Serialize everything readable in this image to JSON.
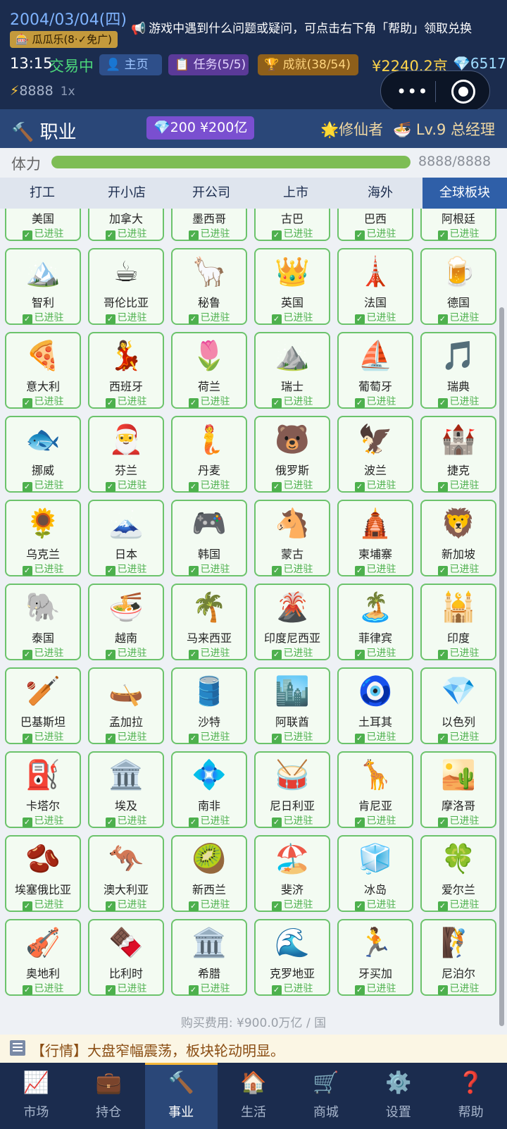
{
  "header": {
    "date": "2004/03/04(四)",
    "ticker": "游戏中遇到什么问题或疑问，可点击右下角「帮助」领取兑换",
    "melon_badge": "🎰 瓜瓜乐(8·✓免广)",
    "time": "13:15",
    "market_status": "交易中",
    "home_btn": "👤 主页",
    "task_btn": "📋 任务(5/5)",
    "achievement_btn": "🏆 成就(38/54)",
    "money": "¥2240.2京",
    "gems": "💎6517",
    "energy": "8888",
    "multiplier": "1x"
  },
  "career": {
    "icon": "🔨",
    "title": "职业",
    "unlock_price": "💎200 ¥200亿",
    "role": "🌟修仙者",
    "level": "🍜 Lv.9 总经理"
  },
  "stamina": {
    "label": "体力",
    "value": "8888/8888",
    "fraction": 1.0,
    "color": "#7dbd55"
  },
  "tabs": [
    {
      "label": "打工",
      "active": false
    },
    {
      "label": "开小店",
      "active": false
    },
    {
      "label": "开公司",
      "active": false
    },
    {
      "label": "上市",
      "active": false
    },
    {
      "label": "海外",
      "active": false
    },
    {
      "label": "全球板块",
      "active": true
    }
  ],
  "status_label": "已进驻",
  "countries": [
    {
      "name": "美国",
      "icon": ""
    },
    {
      "name": "加拿大",
      "icon": ""
    },
    {
      "name": "墨西哥",
      "icon": ""
    },
    {
      "name": "古巴",
      "icon": ""
    },
    {
      "name": "巴西",
      "icon": ""
    },
    {
      "name": "阿根廷",
      "icon": ""
    },
    {
      "name": "智利",
      "icon": "🏔️"
    },
    {
      "name": "哥伦比亚",
      "icon": "☕"
    },
    {
      "name": "秘鲁",
      "icon": "🦙"
    },
    {
      "name": "英国",
      "icon": "👑"
    },
    {
      "name": "法国",
      "icon": "🗼"
    },
    {
      "name": "德国",
      "icon": "🍺"
    },
    {
      "name": "意大利",
      "icon": "🍕"
    },
    {
      "name": "西班牙",
      "icon": "💃"
    },
    {
      "name": "荷兰",
      "icon": "🌷"
    },
    {
      "name": "瑞士",
      "icon": "⛰️"
    },
    {
      "name": "葡萄牙",
      "icon": "⛵"
    },
    {
      "name": "瑞典",
      "icon": "🎵"
    },
    {
      "name": "挪威",
      "icon": "🐟"
    },
    {
      "name": "芬兰",
      "icon": "🎅"
    },
    {
      "name": "丹麦",
      "icon": "🧜"
    },
    {
      "name": "俄罗斯",
      "icon": "🐻"
    },
    {
      "name": "波兰",
      "icon": "🦅"
    },
    {
      "name": "捷克",
      "icon": "🏰"
    },
    {
      "name": "乌克兰",
      "icon": "🌻"
    },
    {
      "name": "日本",
      "icon": "🗻"
    },
    {
      "name": "韩国",
      "icon": "🎮"
    },
    {
      "name": "蒙古",
      "icon": "🐴"
    },
    {
      "name": "柬埔寨",
      "icon": "🛕"
    },
    {
      "name": "新加坡",
      "icon": "🦁"
    },
    {
      "name": "泰国",
      "icon": "🐘"
    },
    {
      "name": "越南",
      "icon": "🍜"
    },
    {
      "name": "马来西亚",
      "icon": "🌴"
    },
    {
      "name": "印度尼西亚",
      "icon": "🌋"
    },
    {
      "name": "菲律宾",
      "icon": "🏝️"
    },
    {
      "name": "印度",
      "icon": "🕌"
    },
    {
      "name": "巴基斯坦",
      "icon": "🏏"
    },
    {
      "name": "孟加拉",
      "icon": "🛶"
    },
    {
      "name": "沙特",
      "icon": "🛢️"
    },
    {
      "name": "阿联酋",
      "icon": "🏙️"
    },
    {
      "name": "土耳其",
      "icon": "🧿"
    },
    {
      "name": "以色列",
      "icon": "💎"
    },
    {
      "name": "卡塔尔",
      "icon": "⛽"
    },
    {
      "name": "埃及",
      "icon": "🏛️"
    },
    {
      "name": "南非",
      "icon": "💠"
    },
    {
      "name": "尼日利亚",
      "icon": "🥁"
    },
    {
      "name": "肯尼亚",
      "icon": "🦒"
    },
    {
      "name": "摩洛哥",
      "icon": "🏜️"
    },
    {
      "name": "埃塞俄比亚",
      "icon": "🫘"
    },
    {
      "name": "澳大利亚",
      "icon": "🦘"
    },
    {
      "name": "新西兰",
      "icon": "🥝"
    },
    {
      "name": "斐济",
      "icon": "🏖️"
    },
    {
      "name": "冰岛",
      "icon": "🧊"
    },
    {
      "name": "爱尔兰",
      "icon": "🍀"
    },
    {
      "name": "奥地利",
      "icon": "🎻"
    },
    {
      "name": "比利时",
      "icon": "🍫"
    },
    {
      "name": "希腊",
      "icon": "🏛️"
    },
    {
      "name": "克罗地亚",
      "icon": "🌊"
    },
    {
      "name": "牙买加",
      "icon": "🏃"
    },
    {
      "name": "尼泊尔",
      "icon": "🧗"
    }
  ],
  "fee_text": "购买费用: ¥900.0万亿 / 国",
  "news": "【行情】大盘窄幅震荡，板块轮动明显。",
  "nav": [
    {
      "label": "市场",
      "icon": "📈",
      "active": false
    },
    {
      "label": "持仓",
      "icon": "💼",
      "active": false
    },
    {
      "label": "事业",
      "icon": "🔨",
      "active": true
    },
    {
      "label": "生活",
      "icon": "🏠",
      "active": false
    },
    {
      "label": "商城",
      "icon": "🛒",
      "active": false
    },
    {
      "label": "设置",
      "icon": "⚙️",
      "active": false
    },
    {
      "label": "帮助",
      "icon": "❓",
      "active": false
    }
  ]
}
